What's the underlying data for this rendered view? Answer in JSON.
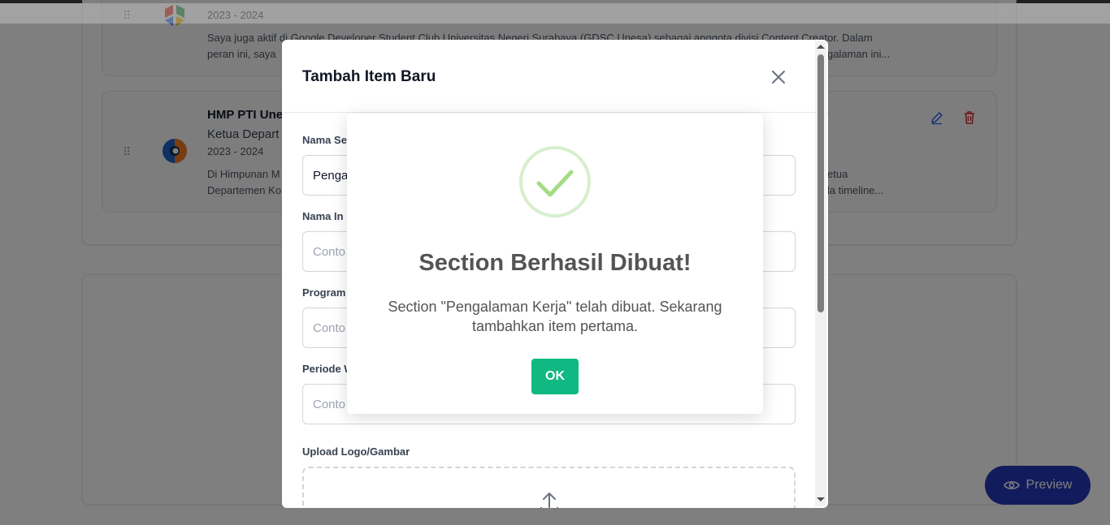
{
  "background": {
    "items": [
      {
        "date": "2023 - 2024",
        "description_line1": "Saya juga aktif di Google Developer Student Club Universitas Negeri Surabaya (GDSC Unesa) sebagai anggota divisi Content Creator. Dalam",
        "description_line2": "peran ini, saya",
        "description_tail": "galaman ini..."
      },
      {
        "title": "HMP PTI Une",
        "role": "Ketua Depart",
        "date": "2023 - 2024",
        "description_line1": "Di Himpunan M",
        "description_line2": "Departemen Ko",
        "description_tail1": "etua",
        "description_tail2": "la timeline..."
      }
    ],
    "preview_label": "Preview"
  },
  "form_modal": {
    "title": "Tambah Item Baru",
    "fields": [
      {
        "label": "Nama Se",
        "value": "Penga",
        "placeholder": ""
      },
      {
        "label": "Nama In",
        "value": "",
        "placeholder": "Conto"
      },
      {
        "label": "Program",
        "value": "",
        "placeholder": "Conto"
      },
      {
        "label": "Periode W",
        "value": "",
        "placeholder": "Conto"
      }
    ],
    "upload_label": "Upload Logo/Gambar"
  },
  "dialog": {
    "title": "Section Berhasil Dibuat!",
    "message": "Section \"Pengalaman Kerja\" telah dibuat. Sekarang tambahkan item pertama.",
    "ok_label": "OK",
    "accent_color": "#10b981",
    "icon": "success-check-icon"
  }
}
